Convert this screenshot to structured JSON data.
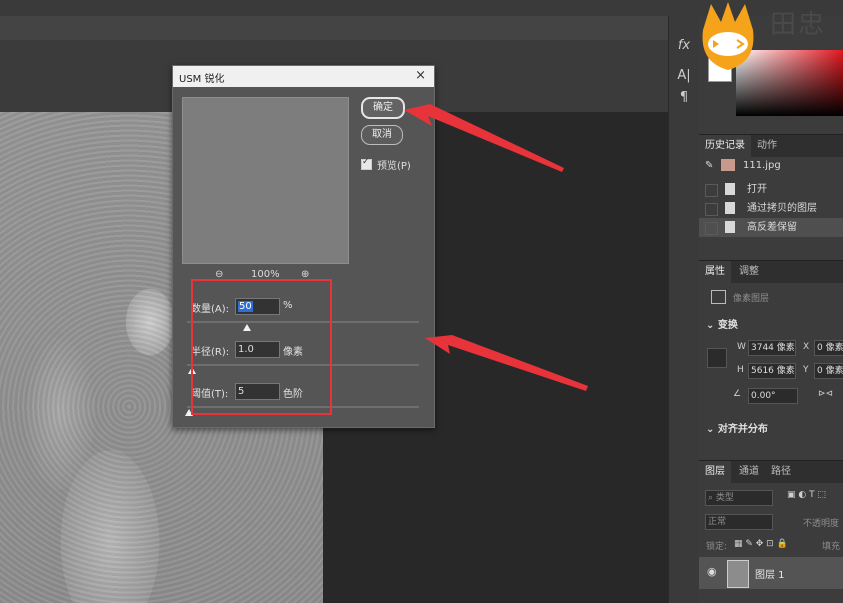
{
  "dialog": {
    "title": "USM 锐化",
    "close": "×",
    "ok_label": "确定",
    "cancel_label": "取消",
    "preview_label": "预览(P)",
    "preview_checked": true,
    "zoom_out": "⊖",
    "zoom_level": "100%",
    "zoom_in": "⊕",
    "amount": {
      "label": "数量(A):",
      "value": "50",
      "unit": "%",
      "slider_fraction": 0.26
    },
    "radius": {
      "label": "半径(R):",
      "value": "1.0",
      "unit": "像素",
      "slider_fraction": 0.02
    },
    "threshold": {
      "label": "阈值(T):",
      "value": "5",
      "unit": "色阶",
      "slider_fraction": 0.01
    }
  },
  "tools": {
    "fx": "fx",
    "char": "A|",
    "para": "¶"
  },
  "logo_text": "田忠",
  "history_panel": {
    "tabs": [
      "历史记录",
      "动作"
    ],
    "snapshot": "111.jpg",
    "items": [
      "打开",
      "通过拷贝的图层",
      "高反差保留"
    ]
  },
  "properties_panel": {
    "tabs": [
      "属性",
      "调整"
    ],
    "layer_type": "像素图层",
    "transform_title": "变换",
    "w_label": "W",
    "w_value": "3744 像素",
    "x_label": "X",
    "x_value": "0 像素",
    "h_label": "H",
    "h_value": "5616 像素",
    "y_label": "Y",
    "y_value": "0 像素",
    "angle_value": "0.00°",
    "align_title": "对齐并分布"
  },
  "layers_panel": {
    "tabs": [
      "图层",
      "通道",
      "路径"
    ],
    "kind_filter": "类型",
    "blend_mode": "正常",
    "opacity_label": "不透明度",
    "lock_label": "锁定:",
    "fill_label": "填充",
    "layer_name": "图层 1"
  },
  "colors": {
    "accent": "#e8333a",
    "selection": "#2d6fd6",
    "logo": "#f5a31a"
  }
}
